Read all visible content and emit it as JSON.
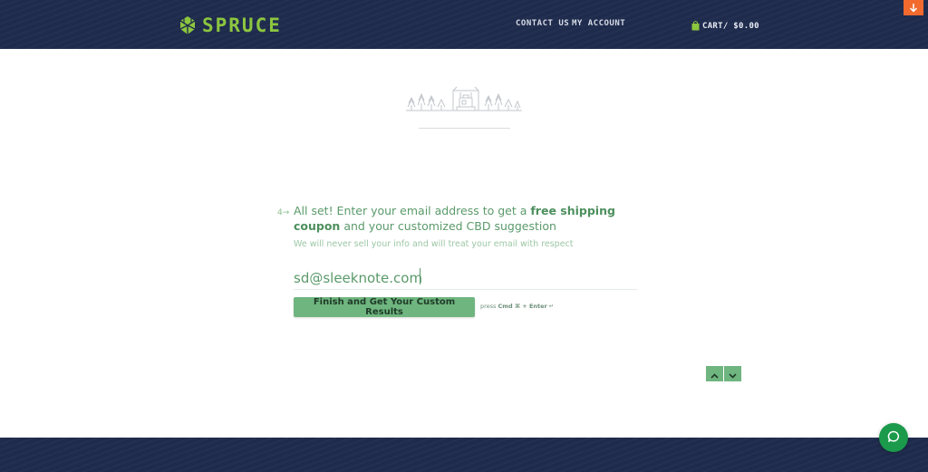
{
  "header": {
    "brand": "SPRUCE",
    "nav": {
      "contact": "CONTACT US",
      "account": "MY ACCOUNT"
    },
    "cart": "CART/ $0.00"
  },
  "question": {
    "number": "4→",
    "title_pre": "All set! Enter your email address to get a ",
    "title_bold": "free shipping coupon",
    "title_post": " and your customized CBD suggestion",
    "subtitle": "We will never sell your info and will treat your email with respect",
    "email_value": "sd@sleeknote.com",
    "submit_label": "Finish and Get Your Custom Results",
    "hint_pre": "press ",
    "hint_keys": "Cmd ⌘ + Enter",
    "hint_icon": "↵"
  },
  "icons": {
    "logo": "spruce-cone-icon",
    "cart": "shopping-bag-icon",
    "scroll": "arrow-down-icon",
    "up": "chevron-up-icon",
    "down": "chevron-down-icon",
    "chat": "chat-bubble-icon"
  },
  "colors": {
    "header_bg": "#1f2b4d",
    "brand_green": "#8cc63f",
    "accent_green": "#6fb57f",
    "text_green": "#5a9a6a",
    "scroll_orange": "#f26a2e",
    "chat_green": "#1a9a4a"
  }
}
